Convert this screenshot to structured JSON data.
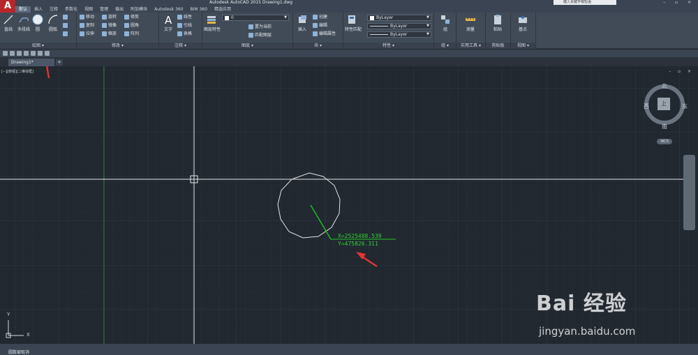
{
  "window": {
    "title": "Autodesk AutoCAD 2015    Drawing1.dwg",
    "search_placeholder": "键入关键字或短语",
    "logo_letter": "A",
    "controls": "– ▫ ×"
  },
  "ribbon_tabs": [
    "默认",
    "插入",
    "注释",
    "参数化",
    "视图",
    "管理",
    "输出",
    "附加模块",
    "Autodesk 360",
    "BIM 360",
    "精选应用"
  ],
  "ribbon": {
    "draw": {
      "panel_label": "绘图 ▾",
      "tools": [
        "直线",
        "多段线",
        "圆",
        "圆弧"
      ]
    },
    "modify": {
      "panel_label": "修改 ▾",
      "tools": [
        "移动",
        "旋转",
        "修剪",
        "复制",
        "镜像",
        "圆角",
        "拉伸",
        "缩放",
        "阵列"
      ]
    },
    "annotation": {
      "panel_label": "注释 ▾",
      "tools": [
        "文字",
        "线性",
        "引线",
        "表格"
      ]
    },
    "layers": {
      "panel_label": "图层 ▾",
      "tools": [
        "图层特性",
        "置为当前",
        "匹配图层"
      ],
      "current_layer": "0"
    },
    "block": {
      "panel_label": "块 ▾",
      "tools": [
        "插入",
        "创建",
        "编辑",
        "编辑属性"
      ]
    },
    "properties": {
      "panel_label": "特性 ▾",
      "tools": [
        "特性匹配"
      ],
      "color": "ByLayer",
      "linetype": "ByLayer",
      "lineweight": "ByLayer"
    },
    "groups": {
      "panel_label": "组 ▾",
      "tools": [
        "组"
      ]
    },
    "utilities": {
      "panel_label": "实用工具 ▾",
      "tools": [
        "测量"
      ]
    },
    "clipboard": {
      "panel_label": "剪贴板",
      "tools": [
        "粘贴"
      ]
    },
    "view": {
      "panel_label": "视图 ▾",
      "tools": [
        "基点"
      ]
    }
  },
  "file_tabs": {
    "active": "Drawing1*",
    "new_tab": "+"
  },
  "viewport": {
    "label": "[−][俯视][二维线框]",
    "controls": "– ▫ ×",
    "viewcube": {
      "north": "北",
      "south": "南",
      "east": "东",
      "west": "西",
      "top": "上",
      "wcs": "WCS"
    },
    "coordinates": {
      "x": "X=2525488.539",
      "y": "Y=475826.311"
    },
    "ucs_x": "X",
    "ucs_y": "Y"
  },
  "command_line": {
    "text": "圆数被取消"
  },
  "watermark": {
    "logo": "Bai 经验",
    "url": "jingyan.baidu.com"
  },
  "colors": {
    "canvas": "#212830",
    "ribbon": "#414b58",
    "coord_text": "#33d233",
    "annotation_arrow": "#e53333",
    "crosshair": "#ffffff"
  }
}
